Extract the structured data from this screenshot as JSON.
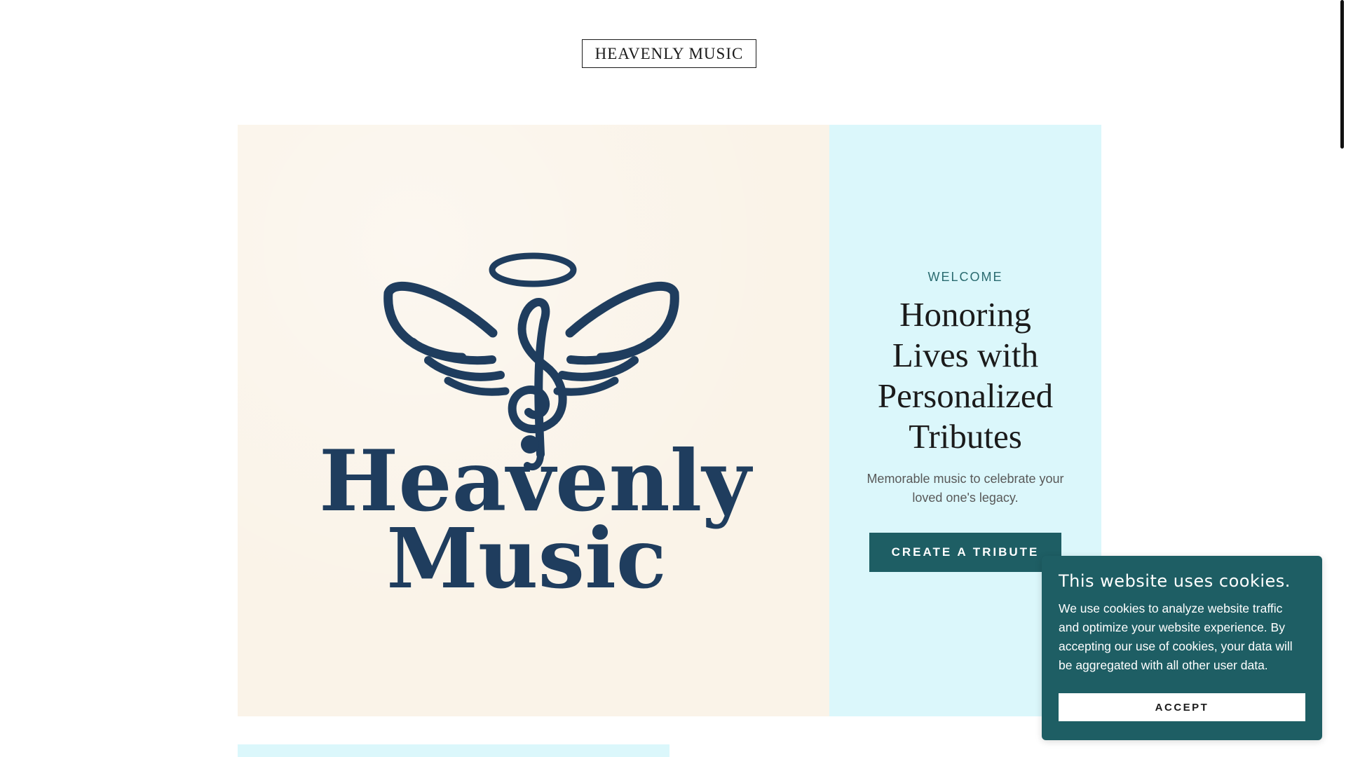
{
  "header": {
    "brand": "HEAVENLY MUSIC"
  },
  "hero": {
    "logo": {
      "line1": "Heavenly",
      "line2": "Music",
      "icon": "angel-wings-treble-clef-icon"
    },
    "eyebrow": "WELCOME",
    "title": "Honoring Lives with Personalized Tributes",
    "subtitle": "Memorable music to celebrate your loved one's legacy.",
    "cta_label": "CREATE A TRIBUTE"
  },
  "cookie_banner": {
    "title": "This website uses cookies.",
    "text": "We use cookies to analyze website traffic and optimize your website experience. By accepting our use of cookies, your data will be aggregated with all other user data.",
    "accept_label": "ACCEPT"
  },
  "colors": {
    "accent": "#1e5e64",
    "panel_bg": "#dbf7fb",
    "image_bg": "#faf3e8",
    "logo_navy": "#1f3d5e"
  }
}
